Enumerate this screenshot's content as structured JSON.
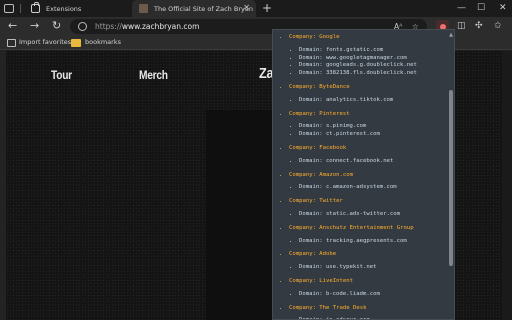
{
  "tabs": [
    {
      "label": "Extensions",
      "active": false
    },
    {
      "label": "The Official Site of Zach Bryan",
      "active": true
    }
  ],
  "address_bar": {
    "url_prefix": "https://",
    "url_host": "www.zachbryan.com"
  },
  "bookmarks": [
    {
      "label": "Import favorites",
      "icon": "image-icon"
    },
    {
      "label": "bookmarks",
      "icon": "folder-icon"
    }
  ],
  "site": {
    "nav": [
      "Tour",
      "Merch",
      "Za"
    ]
  },
  "popup": {
    "company_prefix": "Company:",
    "domain_prefix": "Domain:",
    "companies": [
      {
        "name": "Google",
        "domains": [
          "fonts.gstatic.com",
          "www.googletagmanager.com",
          "googleads.g.doubleclick.net",
          "3382138.fls.doubleclick.net"
        ]
      },
      {
        "name": "ByteDance",
        "domains": [
          "analytics.tiktok.com"
        ]
      },
      {
        "name": "Pinterest",
        "domains": [
          "s.pinimg.com",
          "ct.pinterest.com"
        ]
      },
      {
        "name": "Facebook",
        "domains": [
          "connect.facebook.net"
        ]
      },
      {
        "name": "Amazon.com",
        "domains": [
          "c.amazon-adsystem.com"
        ]
      },
      {
        "name": "Twitter",
        "domains": [
          "static.ads-twitter.com"
        ]
      },
      {
        "name": "Anschutz Entertainment Group",
        "domains": [
          "tracking.aegpresents.com"
        ]
      },
      {
        "name": "Adobe",
        "domains": [
          "use.typekit.net"
        ]
      },
      {
        "name": "LiveIntent",
        "domains": [
          "b-code.liadm.com"
        ]
      },
      {
        "name": "The Trade Desk",
        "domains": [
          "js.adsrvr.org"
        ]
      }
    ]
  },
  "colors": {
    "company": "#ffb02e",
    "domain": "#c9d8e6",
    "popup_bg": "#343a41"
  }
}
